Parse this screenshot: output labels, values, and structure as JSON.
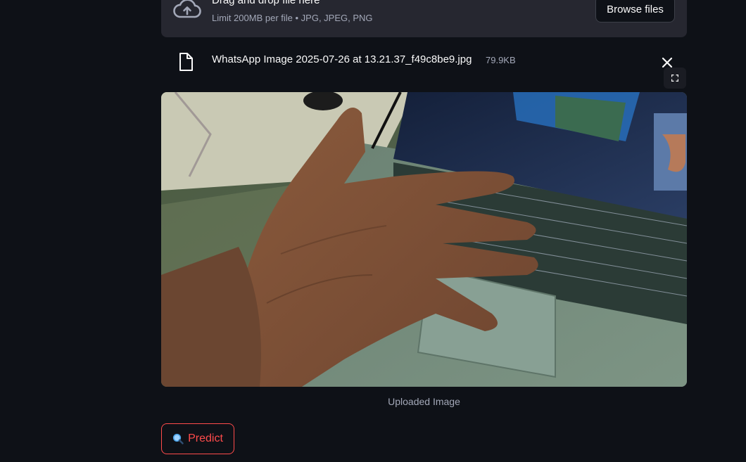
{
  "uploader": {
    "title": "Drag and drop file here",
    "subtitle": "Limit 200MB per file • JPG, JPEG, PNG",
    "browse_label": "Browse files",
    "icon": "cloud-upload-icon"
  },
  "file": {
    "name": "WhatsApp Image 2025-07-26 at 13.21.37_f49c8be9.jpg",
    "size": "79.9KB",
    "icon": "file-icon"
  },
  "image": {
    "caption": "Uploaded Image",
    "alt": "Hand with spread fingers held in front of a laptop keyboard"
  },
  "predict": {
    "label": "Predict",
    "icon": "magnifier-icon"
  },
  "colors": {
    "background": "#0e1117",
    "surface": "#262730",
    "accent": "#ff4b4b",
    "muted_text": "#a3a8b8"
  }
}
